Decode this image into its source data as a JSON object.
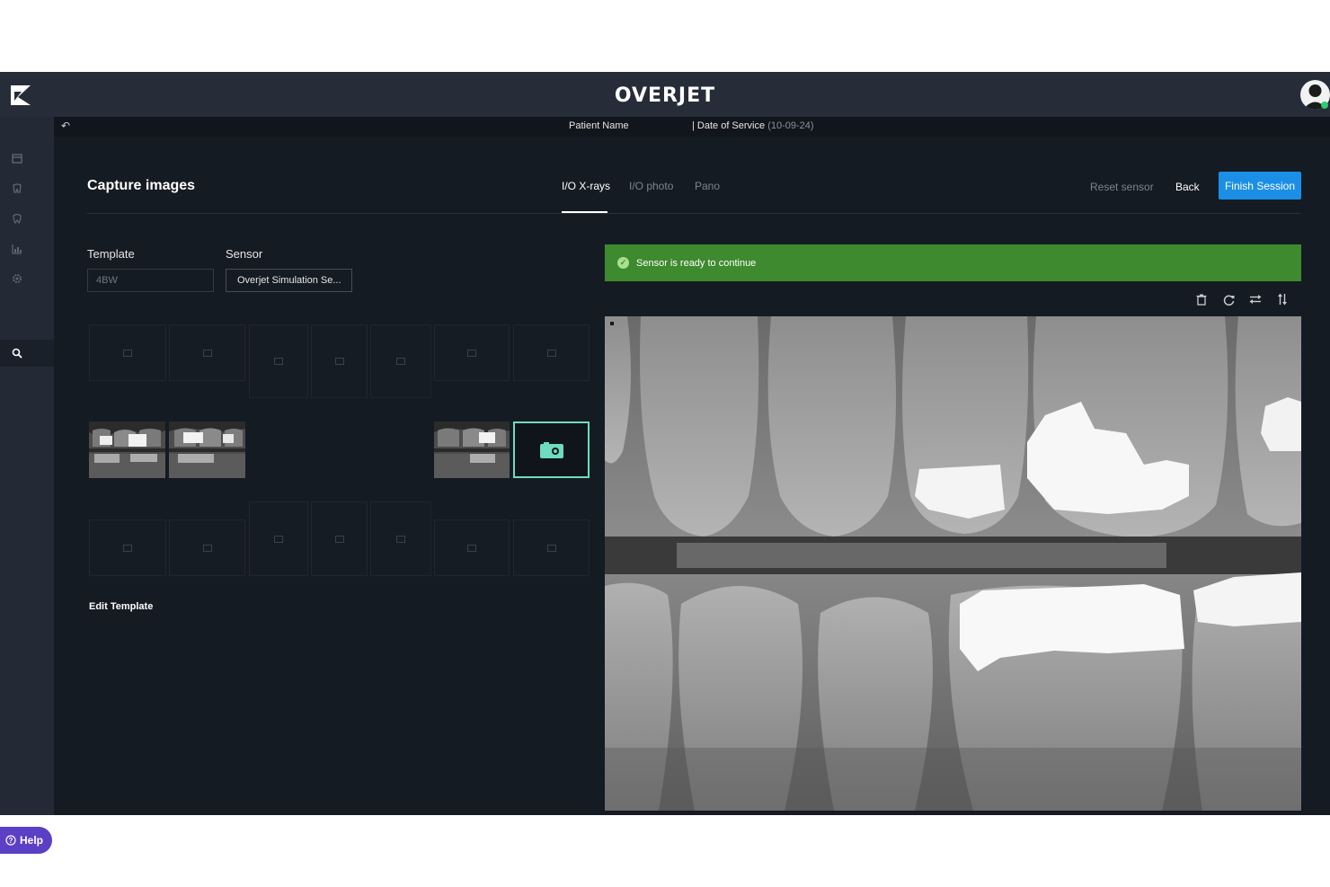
{
  "app": {
    "brand": "OVERJET"
  },
  "patient_bar": {
    "patient_name_label": "Patient Name",
    "date_of_service_label": "| Date of Service",
    "date_of_service_value": "(10-09-24)"
  },
  "page": {
    "title": "Capture images"
  },
  "tabs": [
    {
      "label": "I/O X-rays",
      "active": true
    },
    {
      "label": "I/O photo",
      "active": false
    },
    {
      "label": "Pano",
      "active": false
    }
  ],
  "actions": {
    "reset_sensor": "Reset sensor",
    "back": "Back",
    "finish_session": "Finish Session"
  },
  "form": {
    "template_label": "Template",
    "template_value": "4BW",
    "sensor_label": "Sensor",
    "sensor_value": "Overjet Simulation Se..."
  },
  "edit_template": "Edit Template",
  "banner": {
    "message": "Sensor is ready to continue"
  },
  "help": {
    "label": "Help"
  },
  "sidebar_icons": [
    "calendar-icon",
    "tooth-chart-icon",
    "tooth-icon",
    "analytics-icon",
    "settings-icon",
    "search-icon"
  ],
  "toolbar_icons": [
    "trash-icon",
    "rotate-icon",
    "flip-horizontal-icon",
    "flip-vertical-icon"
  ],
  "colors": {
    "primary": "#1b8fe6",
    "success": "#3e8a2e",
    "accent": "#6ddcc0",
    "help": "#5b3fc4"
  }
}
